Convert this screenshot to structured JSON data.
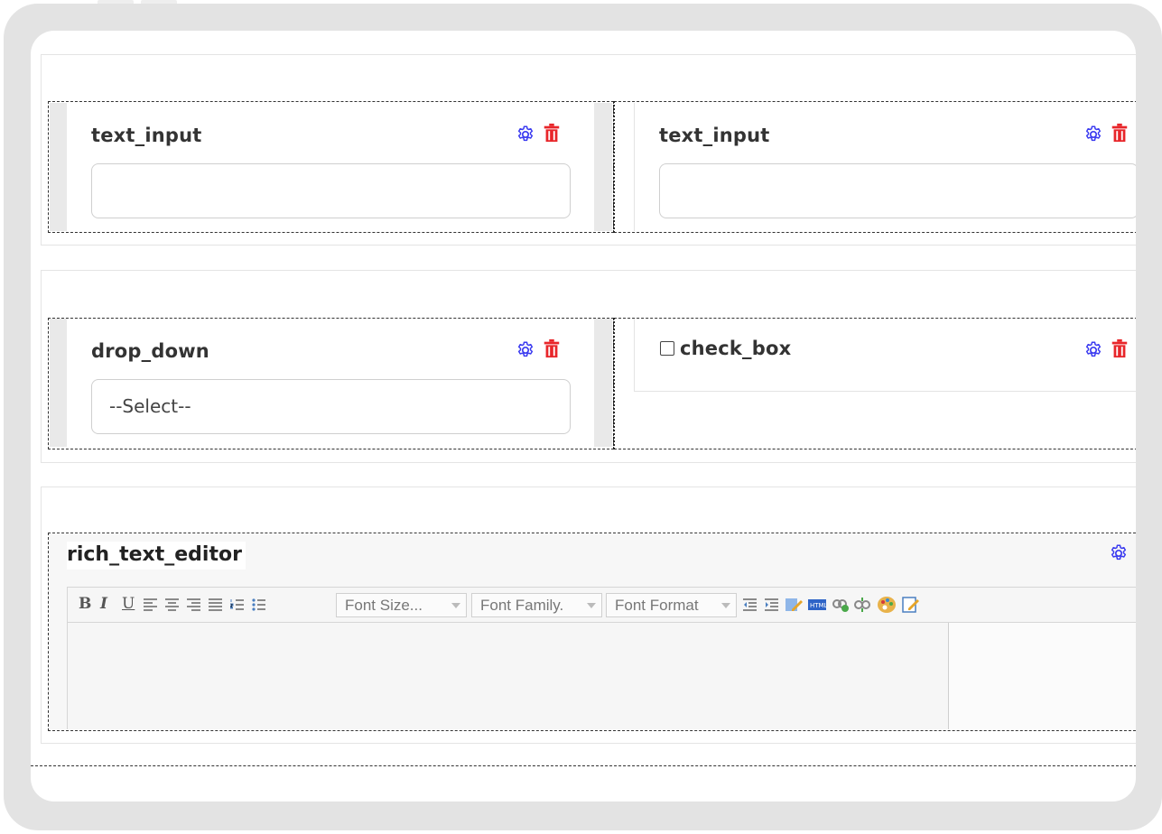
{
  "form_builder": {
    "row1": {
      "left_field": {
        "label": "text_input",
        "value": ""
      },
      "right_field": {
        "label": "text_input",
        "value": ""
      }
    },
    "row2": {
      "left_field": {
        "label": "drop_down",
        "selected": "--Select--"
      },
      "right_field": {
        "label": "check_box",
        "checked": false
      }
    },
    "row3": {
      "rich_text": {
        "label": "rich_text_editor",
        "toolbar": {
          "bold": "B",
          "italic": "I",
          "underline": "U",
          "font_size": "Font Size...",
          "font_family": "Font Family.",
          "font_format": "Font Format"
        }
      }
    }
  },
  "icons": {
    "settings": "gear-icon",
    "delete": "trash-icon"
  },
  "colors": {
    "settings_icon": "#3a3af0",
    "delete_icon": "#e8262a",
    "frame": "#e3e3e3",
    "dashed_border": "#333333"
  }
}
